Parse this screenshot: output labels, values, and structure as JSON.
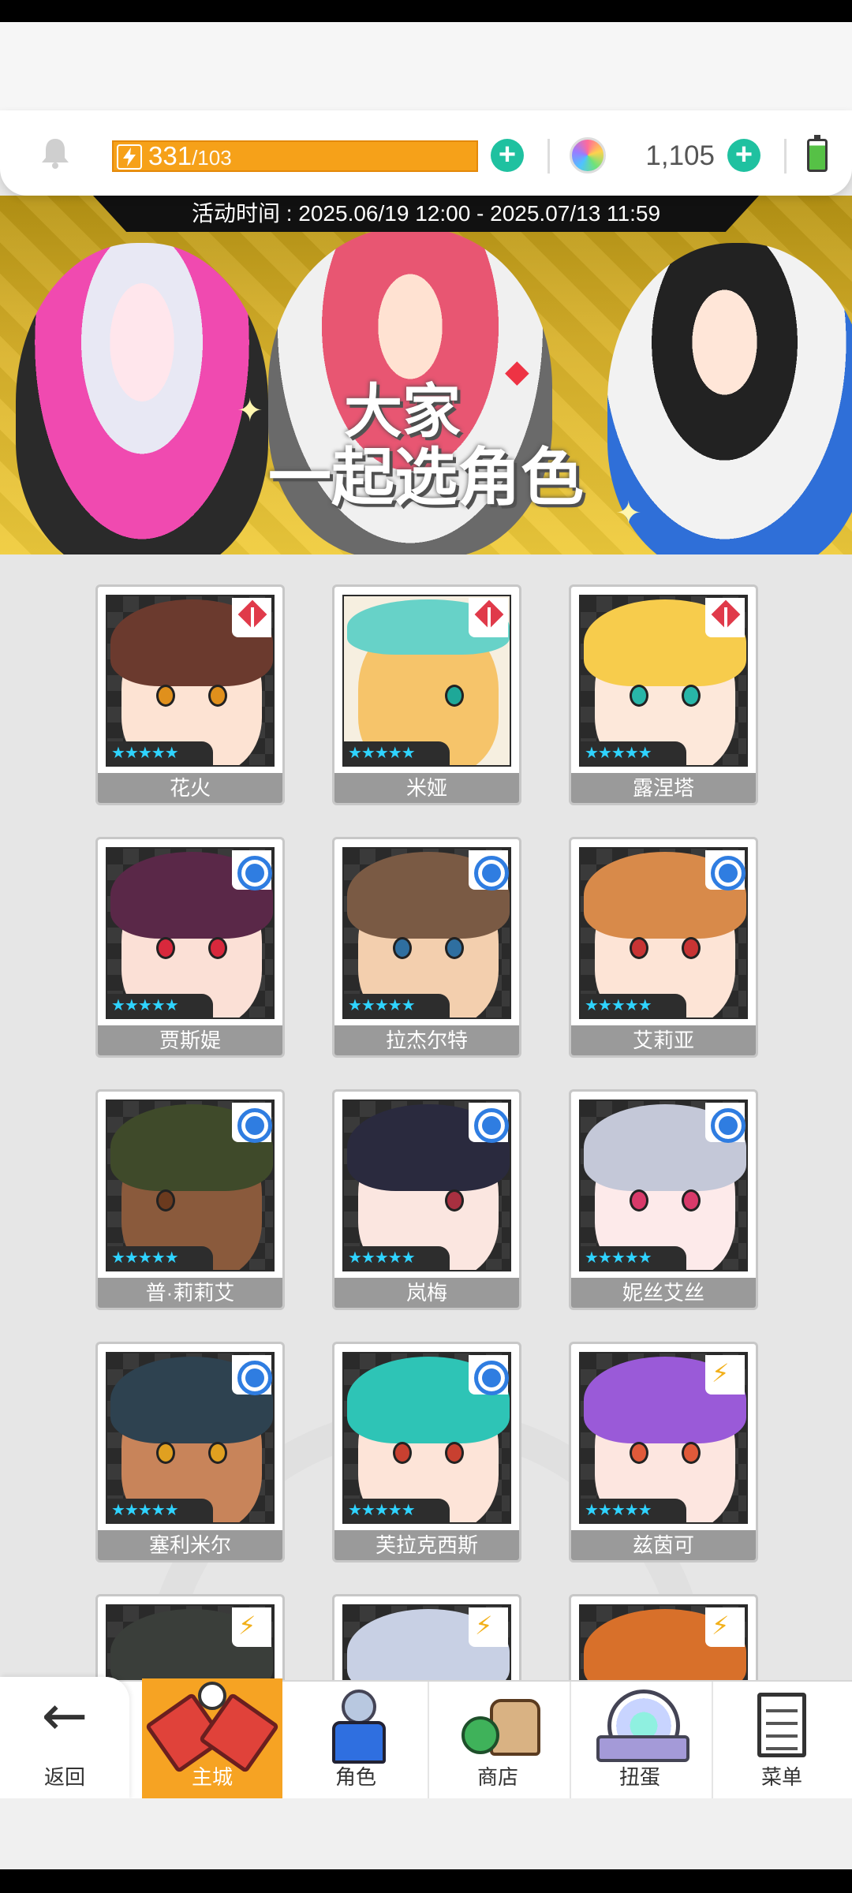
{
  "header": {
    "energy_current": "331",
    "energy_max": "/103",
    "energy_progress": 1.0,
    "gems": "1,105",
    "icons": [
      "bell-icon",
      "bolt-icon",
      "plus-icon",
      "gem-icon",
      "battery-icon"
    ],
    "colors": {
      "energy": "#f6a119",
      "plus": "#1fc1a0"
    }
  },
  "banner": {
    "period": "活动时间 : 2025.06/19 12:00 - 2025.07/13 11:59",
    "title_line1": "大家",
    "title_line2": "一起选角色"
  },
  "characters": [
    {
      "name": "花火",
      "stars": "★★★★★",
      "rarity_icon": "diamond-icon"
    },
    {
      "name": "米娅",
      "stars": "★★★★★",
      "rarity_icon": "diamond-icon"
    },
    {
      "name": "露涅塔",
      "stars": "★★★★★",
      "rarity_icon": "diamond-icon"
    },
    {
      "name": "贾斯媞",
      "stars": "★★★★★",
      "rarity_icon": "circle-icon"
    },
    {
      "name": "拉杰尔特",
      "stars": "★★★★★",
      "rarity_icon": "circle-icon"
    },
    {
      "name": "艾莉亚",
      "stars": "★★★★★",
      "rarity_icon": "circle-icon"
    },
    {
      "name": "普·莉莉艾",
      "stars": "★★★★★",
      "rarity_icon": "circle-icon"
    },
    {
      "name": "岚梅",
      "stars": "★★★★★",
      "rarity_icon": "circle-icon"
    },
    {
      "name": "妮丝艾丝",
      "stars": "★★★★★",
      "rarity_icon": "circle-icon"
    },
    {
      "name": "塞利米尔",
      "stars": "★★★★★",
      "rarity_icon": "circle-icon"
    },
    {
      "name": "芙拉克西斯",
      "stars": "★★★★★",
      "rarity_icon": "circle-icon"
    },
    {
      "name": "兹茵可",
      "stars": "★★★★★",
      "rarity_icon": "bolt-icon"
    }
  ],
  "partial_cards": [
    "bolt-icon",
    "bolt-icon",
    "bolt-icon"
  ],
  "nav": {
    "back": "返回",
    "main_city": "主城",
    "character": "角色",
    "shop": "商店",
    "gacha": "扭蛋",
    "menu": "菜单",
    "active": "主城",
    "active_color": "#f6a323"
  }
}
